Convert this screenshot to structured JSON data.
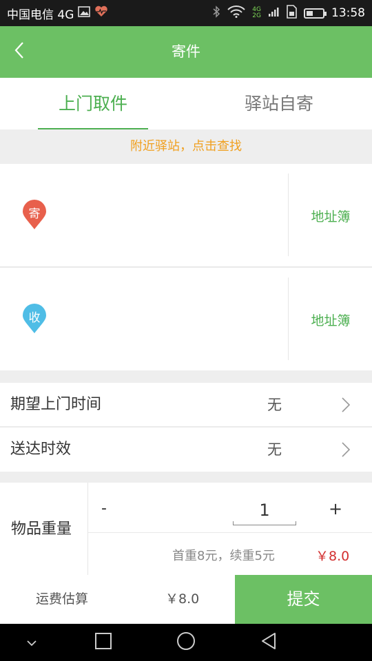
{
  "status_bar": {
    "carrier": "中国电信 4G",
    "net_top": "4G",
    "net_bottom": "2G",
    "time": "13:58"
  },
  "header": {
    "title": "寄件",
    "back_icon": "chevron-left-icon"
  },
  "tabs": [
    {
      "label": "上门取件",
      "active": true
    },
    {
      "label": "驿站自寄",
      "active": false
    }
  ],
  "notice": "附近驿站，点击查找",
  "sender": {
    "badge": "寄",
    "color": "#e8604c",
    "address_book": "地址簿"
  },
  "receiver": {
    "badge": "收",
    "color": "#4fbde6",
    "address_book": "地址簿"
  },
  "rows": [
    {
      "label": "期望上门时间",
      "value": "无"
    },
    {
      "label": "送达时效",
      "value": "无"
    }
  ],
  "weight": {
    "label": "物品重量",
    "minus": "-",
    "quantity": "1",
    "plus": "+",
    "rule": "首重8元，续重5元",
    "price": "￥8.0"
  },
  "footer": {
    "estimate_label": "运费估算",
    "estimate_value": "￥8.0",
    "submit": "提交"
  },
  "colors": {
    "brand": "#6cc064",
    "accent": "#4caf50",
    "notice": "#f0a020",
    "price": "#d32f2f"
  }
}
